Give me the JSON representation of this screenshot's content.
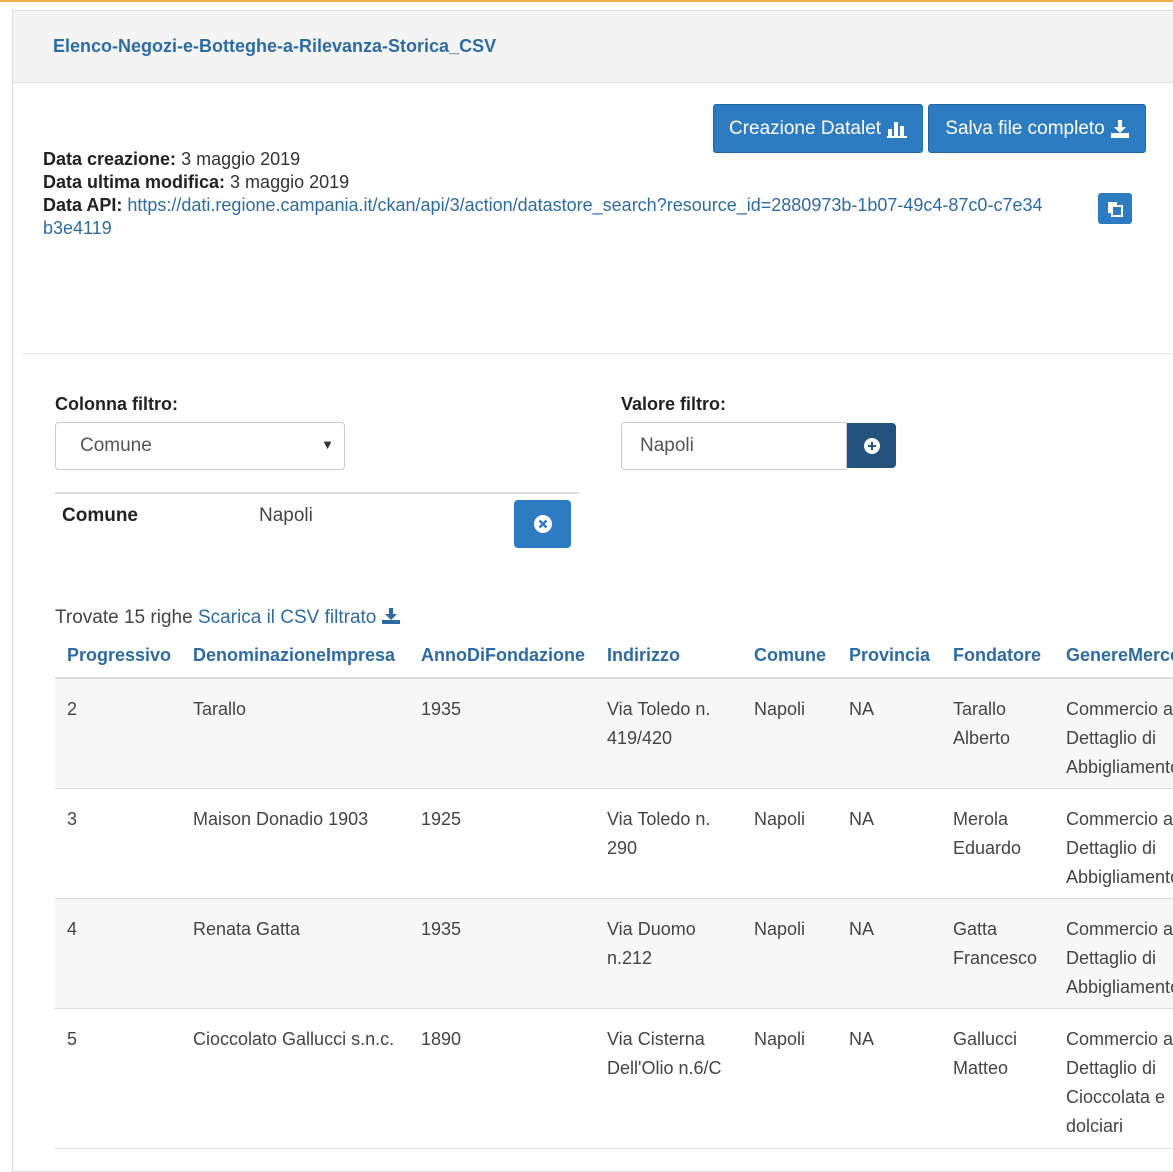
{
  "panel": {
    "title": "Elenco-Negozi-e-Botteghe-a-Rilevanza-Storica_CSV"
  },
  "buttons": {
    "datalet": "Creazione Datalet",
    "save": "Salva file completo"
  },
  "meta": {
    "created_label": "Data creazione:",
    "created_value": "3 maggio 2019",
    "modified_label": "Data ultima modifica:",
    "modified_value": "3 maggio 2019",
    "api_label": "Data API:",
    "api_url": "https://dati.regione.campania.it/ckan/api/3/action/datastore_search?resource_id=2880973b-1b07-49c4-87c0-c7e34b3e4119"
  },
  "filter": {
    "column_label": "Colonna filtro:",
    "column_value": "Comune",
    "value_label": "Valore filtro:",
    "value_value": "Napoli",
    "active": {
      "column": "Comune",
      "value": "Napoli"
    }
  },
  "results": {
    "found_text": "Trovate 15 righe",
    "download_link": "Scarica il CSV filtrato"
  },
  "table": {
    "headers": [
      "Progressivo",
      "DenominazioneImpresa",
      "AnnoDiFondazione",
      "Indirizzo",
      "Comune",
      "Provincia",
      "Fondatore",
      "GenereMerceologico"
    ],
    "rows": [
      [
        "2",
        "Tarallo",
        "1935",
        "Via Toledo n. 419/420",
        "Napoli",
        "NA",
        "Tarallo Alberto",
        "Commercio al Dettaglio di Abbigliamento"
      ],
      [
        "3",
        "Maison Donadio 1903",
        "1925",
        "Via Toledo n. 290",
        "Napoli",
        "NA",
        "Merola Eduardo",
        "Commercio al Dettaglio di Abbigliamento"
      ],
      [
        "4",
        "Renata Gatta",
        "1935",
        "Via Duomo n.212",
        "Napoli",
        "NA",
        "Gatta Francesco",
        "Commercio al Dettaglio di Abbigliamento"
      ],
      [
        "5",
        "Cioccolato Gallucci s.n.c.",
        "1890",
        "Via Cisterna Dell'Olio n.6/C",
        "Napoli",
        "NA",
        "Gallucci Matteo",
        "Commercio al Dettaglio di Cioccolata e dolciari"
      ]
    ]
  },
  "colors": {
    "accent": "#2d7bc0",
    "link": "#2d6ca2",
    "dark_button": "#23527c"
  }
}
